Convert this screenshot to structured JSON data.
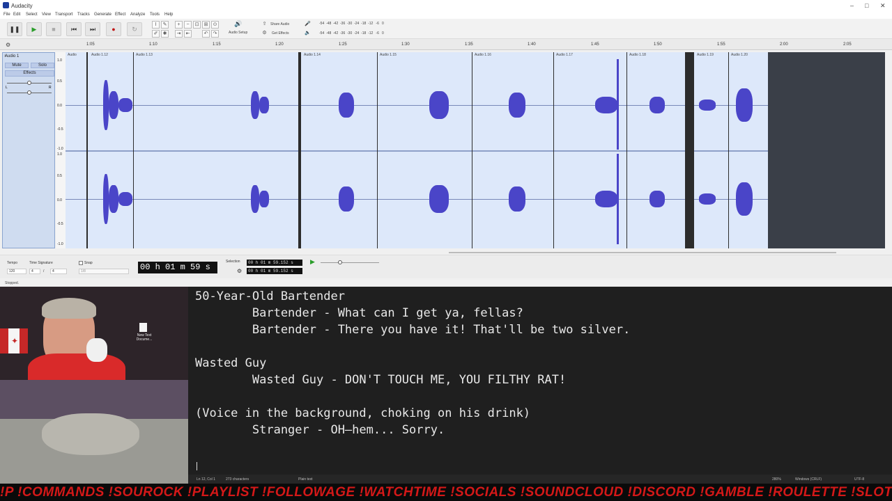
{
  "window": {
    "title": "Audacity",
    "controls": [
      "–",
      "□",
      "✕"
    ]
  },
  "menu": [
    "File",
    "Edit",
    "Select",
    "View",
    "Transport",
    "Tracks",
    "Generate",
    "Effect",
    "Analyze",
    "Tools",
    "Help"
  ],
  "toolbar": {
    "audio_setup": "Audio Setup",
    "share_audio": "Share Audio",
    "get_effects": "Get Effects",
    "meter_top": "-54  -48  -42  -36  -30  -24  -18  -12   -6   0",
    "meter_bottom": "-54  -48  -42  -36  -30  -24  -18  -12   -6   0"
  },
  "ruler": [
    "1:05",
    "1:10",
    "1:15",
    "1:20",
    "1:25",
    "1:30",
    "1:35",
    "1:40",
    "1:45",
    "1:50",
    "1:55",
    "2:00",
    "2:05"
  ],
  "track": {
    "name": "Audio 1",
    "mute": "Mute",
    "solo": "Solo",
    "effects": "Effects",
    "clips": [
      "Audio",
      "Audio 1.12",
      "Audio 1.13",
      "Audio 1.14",
      "Audio 1.15",
      "Audio 1.16",
      "Audio 1.17",
      "Audio 1.18",
      "Audio 1.19",
      "Audio 1.20"
    ],
    "scale": [
      "1.0",
      "0.5",
      "0.0",
      "-0.5",
      "-1.0",
      "1.0",
      "0.5",
      "0.0",
      "-0.5",
      "-1.0"
    ],
    "gain_l": "L",
    "gain_r": "R"
  },
  "bottom": {
    "tempo_label": "Tempo",
    "tempo_value": "120",
    "timesig_label": "Time Signature",
    "timesig_num": "4",
    "timesig_sep": "/",
    "timesig_den": "4",
    "snap_label": "Snap",
    "snap_value": "1/8",
    "time": "00 h 01 m 59 s",
    "selection_label": "Selection",
    "sel_start": "00 h 01 m 59.152 s",
    "sel_end": "00 h 01 m 59.152 s"
  },
  "status": "Stopped.",
  "notepad": {
    "lines": [
      "50-Year-Old Bartender",
      "        Bartender - What can I get ya, fellas?",
      "        Bartender - There you have it! That'll be two silver.",
      "",
      "Wasted Guy",
      "        Wasted Guy - DON'T TOUCH ME, YOU FILTHY RAT!",
      "",
      "(Voice in the background, choking on his drink)",
      "        Stranger - OH—hem... Sorry."
    ],
    "position": "Ln 12, Col 1",
    "chars": "273 characters",
    "format": "Plain text",
    "zoom": "280%",
    "eol": "Windows (CRLF)",
    "encoding": "UTF-8"
  },
  "desktop_icon": "New Text Docume...",
  "ticker": "!P !COMMANDS  !SOUROCK  !PLAYLIST  !FOLLOWAGE  !WATCHTIME  !SOCIALS  !SOUNDCLOUD  !DISCORD  !GAMBLE  !ROULETTE  !SLOTS  !DUEL"
}
